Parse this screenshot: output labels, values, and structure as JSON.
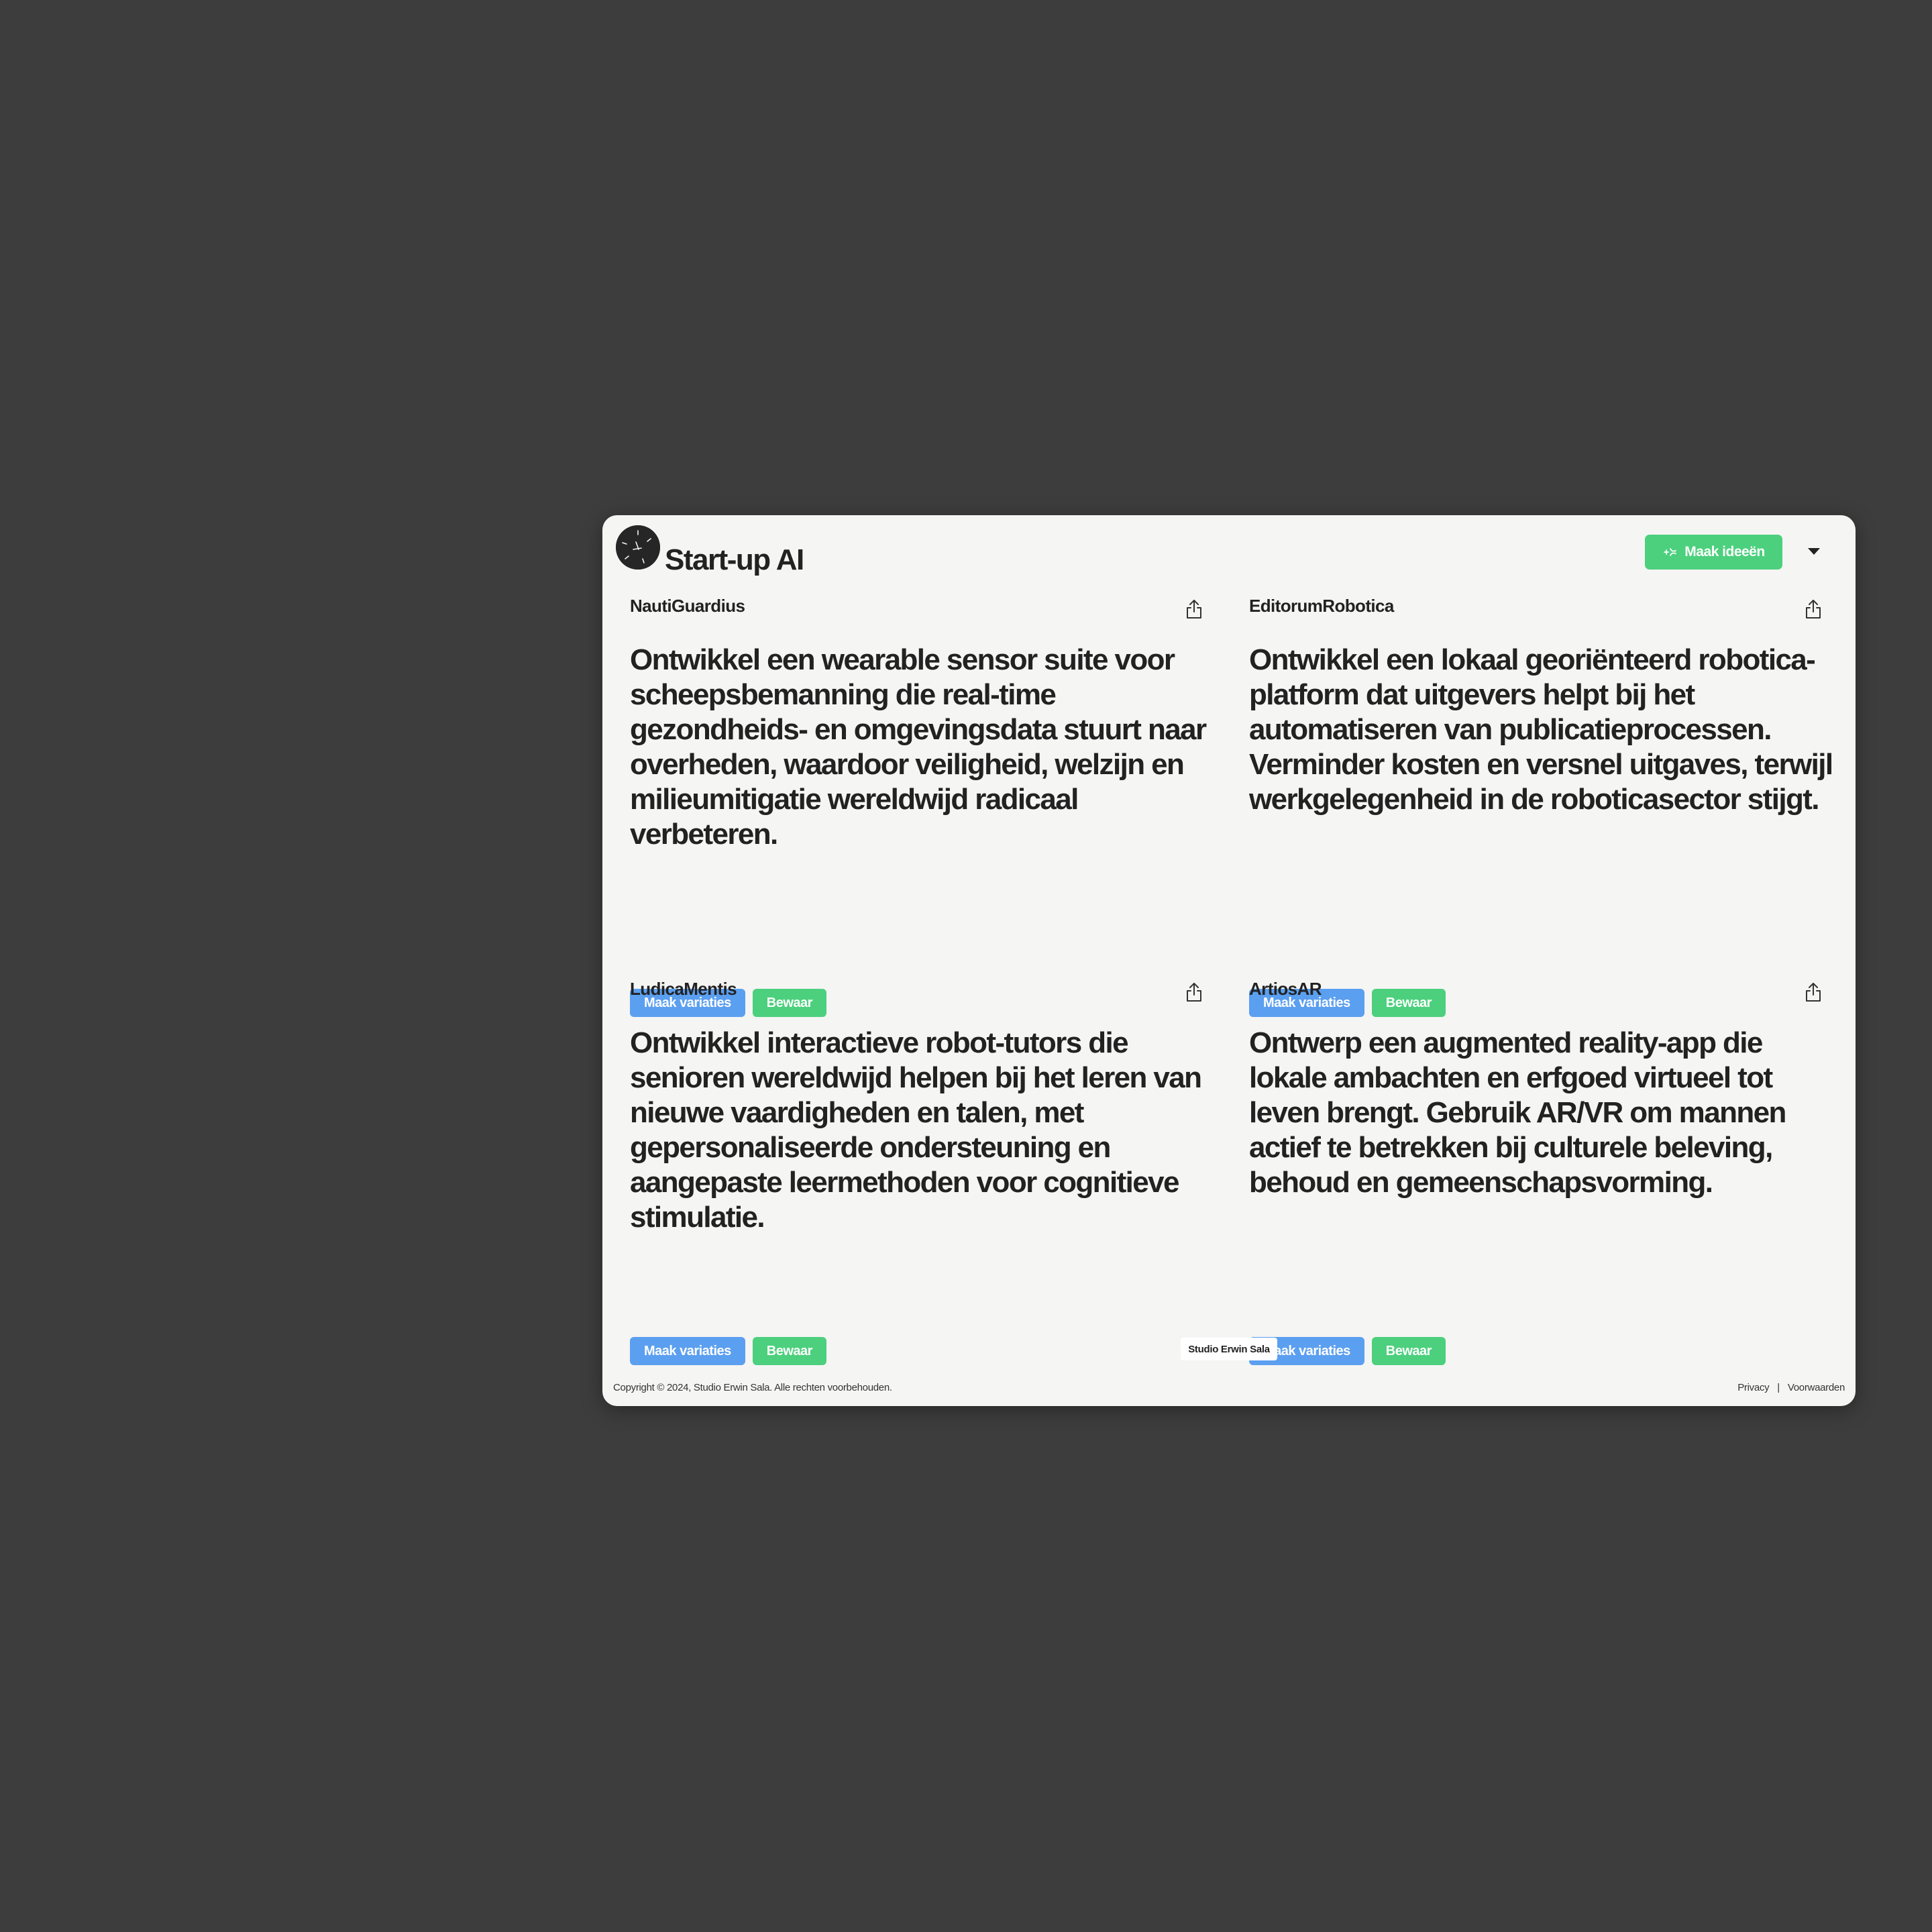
{
  "header": {
    "title": "Start-up AI",
    "make_ideas_label": "Maak ideeën",
    "dropdown_icon": "caret-down-icon"
  },
  "cards": [
    {
      "name": "NautiGuardius",
      "text": "Ontwikkel een wearable sensor suite voor scheepsbemanning die real-time gezondheids- en omgevingsdata stuurt naar overheden, waardoor veiligheid, welzijn en milieumitigatie wereldwijd radicaal verbeteren.",
      "variations_label": "Maak variaties",
      "save_label": "Bewaar"
    },
    {
      "name": "EditorumRobotica",
      "text": "Ontwikkel een lokaal georiënteerd robotica-platform dat uitgevers helpt bij het automatiseren van publicatieprocessen. Verminder kosten en versnel uitgaves, terwijl werkgelegenheid in de roboticasector stijgt.",
      "variations_label": "Maak variaties",
      "save_label": "Bewaar"
    },
    {
      "name": "LudicaMentis",
      "text": "Ontwikkel interactieve robot-tutors die senioren wereldwijd helpen bij het leren van nieuwe vaardigheden en talen, met gepersonaliseerde ondersteuning en aangepaste leermethoden voor cognitieve stimulatie.",
      "variations_label": "Maak variaties",
      "save_label": "Bewaar"
    },
    {
      "name": "ArtiosAR",
      "text": "Ontwerp een augmented reality-app die lokale ambachten en erfgoed virtueel tot leven brengt. Gebruik AR/VR om mannen actief te betrekken bij culturele beleving, behoud en gemeenschapsvorming.",
      "variations_label": "Maak variaties",
      "save_label": "Bewaar"
    }
  ],
  "footer": {
    "studio": "Studio Erwin Sala",
    "copyright": "Copyright © 2024, Studio Erwin Sala. Alle rechten voorbehouden.",
    "privacy": "Privacy",
    "separator": "|",
    "terms": "Voorwaarden"
  },
  "colors": {
    "background": "#3d3d3d",
    "panel": "#f5f5f4",
    "green": "#4cd07d",
    "blue": "#5b9ff0",
    "text": "#222222"
  }
}
